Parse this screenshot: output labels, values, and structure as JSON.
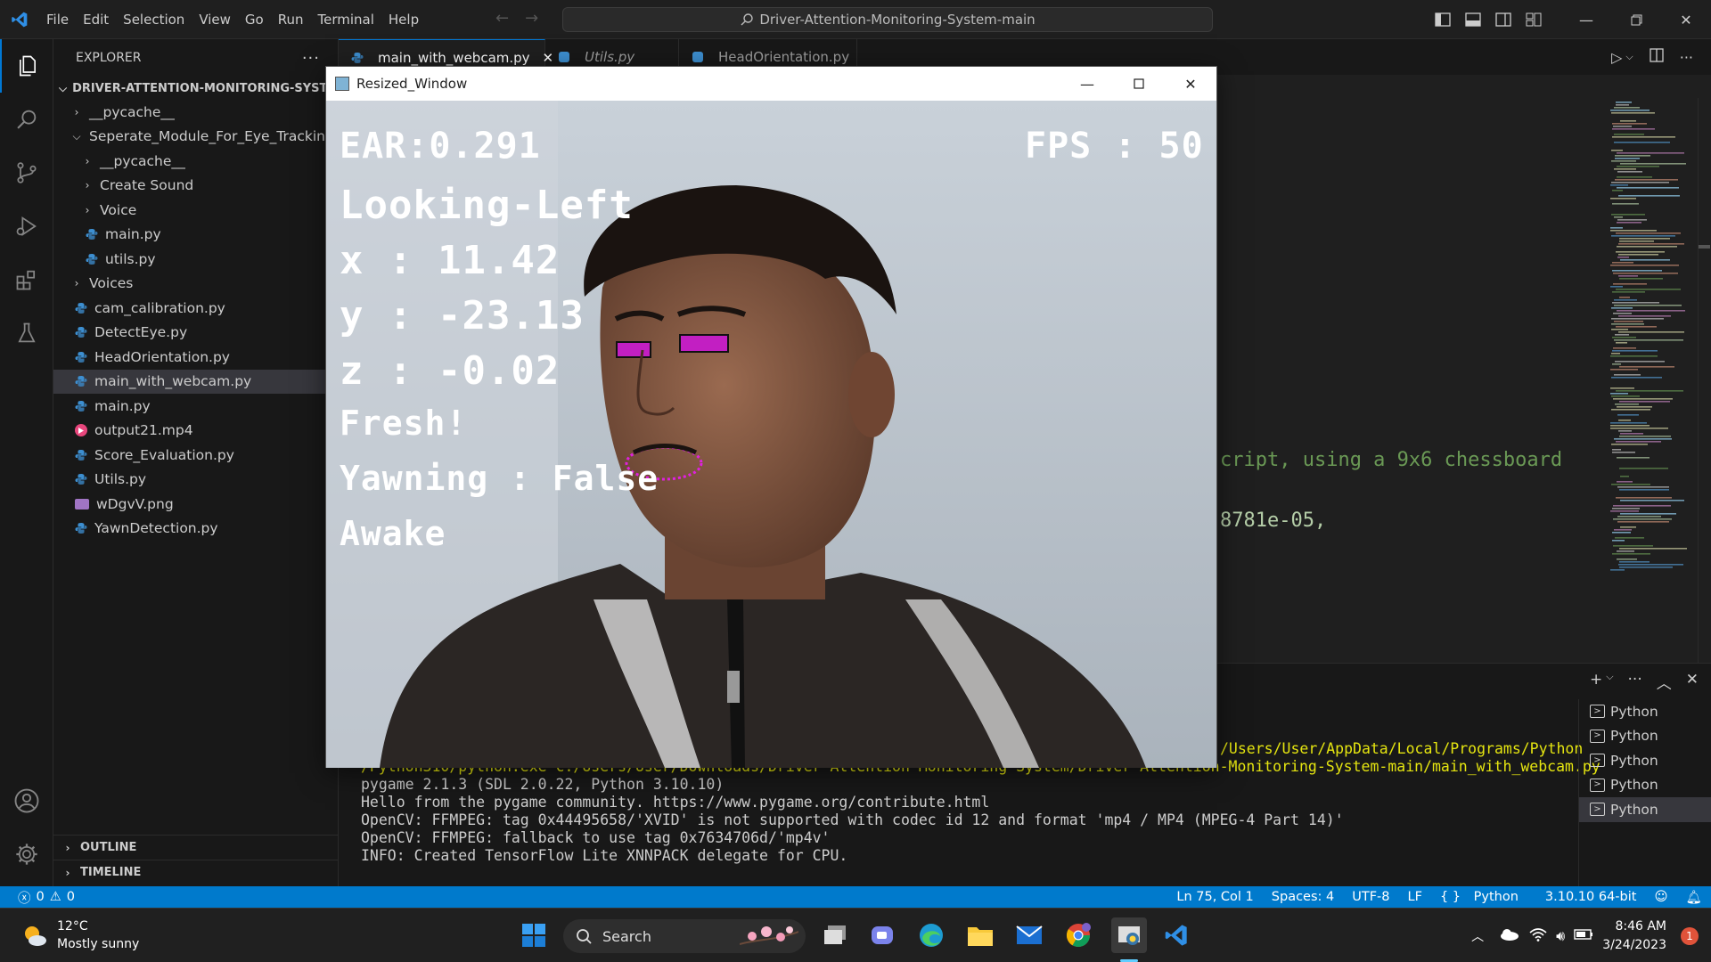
{
  "titlebar": {
    "menu": [
      "File",
      "Edit",
      "Selection",
      "View",
      "Go",
      "Run",
      "Terminal",
      "Help"
    ],
    "search": "Driver-Attention-Monitoring-System-main"
  },
  "sidebar": {
    "title": "EXPLORER",
    "root": "DRIVER-ATTENTION-MONITORING-SYSTE...",
    "items": [
      {
        "label": "__pycache__",
        "kind": "folder",
        "depth": 1
      },
      {
        "label": "Seperate_Module_For_Eye_Tracking",
        "kind": "folder-open",
        "depth": 1
      },
      {
        "label": "__pycache__",
        "kind": "folder",
        "depth": 2
      },
      {
        "label": "Create Sound",
        "kind": "folder",
        "depth": 2
      },
      {
        "label": "Voice",
        "kind": "folder",
        "depth": 2
      },
      {
        "label": "main.py",
        "kind": "py",
        "depth": 2
      },
      {
        "label": "utils.py",
        "kind": "py",
        "depth": 2
      },
      {
        "label": "Voices",
        "kind": "folder",
        "depth": 1
      },
      {
        "label": "cam_calibration.py",
        "kind": "py",
        "depth": 1
      },
      {
        "label": "DetectEye.py",
        "kind": "py",
        "depth": 1
      },
      {
        "label": "HeadOrientation.py",
        "kind": "py",
        "depth": 1
      },
      {
        "label": "main_with_webcam.py",
        "kind": "py",
        "depth": 1,
        "selected": true
      },
      {
        "label": "main.py",
        "kind": "py",
        "depth": 1
      },
      {
        "label": "output21.mp4",
        "kind": "mp4",
        "depth": 1
      },
      {
        "label": "Score_Evaluation.py",
        "kind": "py",
        "depth": 1
      },
      {
        "label": "Utils.py",
        "kind": "py",
        "depth": 1
      },
      {
        "label": "wDgvV.png",
        "kind": "png",
        "depth": 1
      },
      {
        "label": "YawnDetection.py",
        "kind": "py",
        "depth": 1
      }
    ],
    "outline": "OUTLINE",
    "timeline": "TIMELINE"
  },
  "tabs": [
    {
      "label": "main_with_webcam.py",
      "active": true
    },
    {
      "label": "Utils.py",
      "italic": true
    },
    {
      "label": "HeadOrientation.py"
    }
  ],
  "editor": {
    "visible_fragments": [
      "cript, using a 9x6 chessboard",
      "8781e-05,"
    ]
  },
  "terminal": {
    "path_fragment": "/Users/User/AppData/Local/Programs/Python",
    "cmd_fragment": "/Python310/python.exe c:/Users/User/Downloads/Driver-Attention-Monitoring-System/Driver-Attention-Monitoring-System-main/main_with_webcam.py",
    "lines": [
      "pygame 2.1.3 (SDL 2.0.22, Python 3.10.10)",
      "Hello from the pygame community. https://www.pygame.org/contribute.html",
      "OpenCV: FFMPEG: tag 0x44495658/'XVID' is not supported with codec id 12 and format 'mp4 / MP4 (MPEG-4 Part 14)'",
      "OpenCV: FFMPEG: fallback to use tag 0x7634706d/'mp4v'",
      "INFO: Created TensorFlow Lite XNNPACK delegate for CPU."
    ],
    "instances": [
      "Python",
      "Python",
      "Python",
      "Python",
      "Python"
    ]
  },
  "statusbar": {
    "errors": "0",
    "warnings": "0",
    "position": "Ln 75, Col 1",
    "spaces": "Spaces: 4",
    "encoding": "UTF-8",
    "eol": "LF",
    "language": "Python",
    "interpreter": "3.10.10 64-bit"
  },
  "cv_window": {
    "title": "Resized_Window",
    "ear": "EAR:0.291",
    "fps": "FPS : 50",
    "direction": "Looking-Left",
    "x": "x : 11.42",
    "y": "y : -23.13",
    "z": "z : -0.02",
    "fresh": "Fresh!",
    "yawning": "Yawning : False",
    "state": "Awake"
  },
  "taskbar": {
    "temp": "12°C",
    "weather": "Mostly sunny",
    "search": "Search",
    "time": "8:46 AM",
    "date": "3/24/2023",
    "notifications": "1"
  },
  "colors": {
    "accent": "#0078d4",
    "statusbar": "#007acc",
    "eye_box": "#ff00ff"
  }
}
